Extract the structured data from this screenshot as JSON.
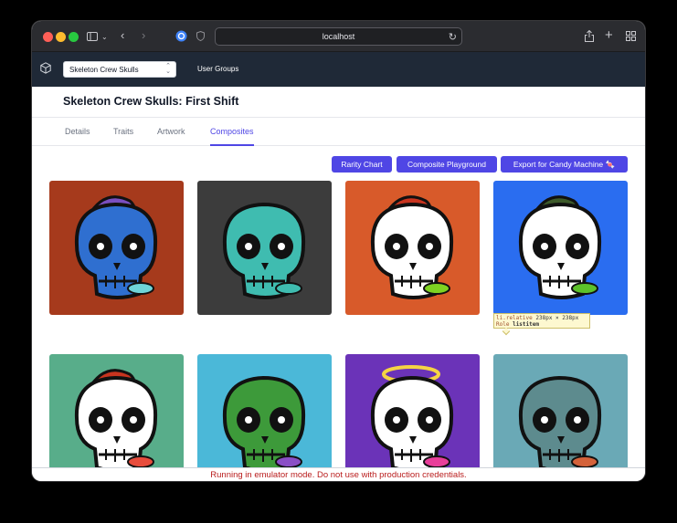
{
  "browser": {
    "url": "localhost"
  },
  "app": {
    "project_select": "Skeleton Crew Skulls",
    "nav_link": "User Groups"
  },
  "page": {
    "title": "Skeleton Crew Skulls: First Shift"
  },
  "tabs": [
    {
      "label": "Details"
    },
    {
      "label": "Traits"
    },
    {
      "label": "Artwork"
    },
    {
      "label": "Composites"
    }
  ],
  "active_tab": "Composites",
  "actions": {
    "rarity_chart": "Rarity Chart",
    "composite_playground": "Composite Playground",
    "export_candy_machine": "Export for Candy Machine 🍬"
  },
  "composites": [
    {
      "bg": "#a63a1c",
      "skull": "#2f6fd0",
      "hat": "#7a4fbf",
      "accent": "#6fd4d8"
    },
    {
      "bg": "#3c3c3c",
      "skull": "#3fbcb0",
      "hat": "none",
      "accent": "#3fbcb0"
    },
    {
      "bg": "#d85a2a",
      "skull": "#ffffff",
      "hat": "#c8341f",
      "accent": "#7ed321"
    },
    {
      "bg": "#2a6df0",
      "skull": "#ffffff",
      "hat": "#3d5a2a",
      "accent": "#5cc22a"
    },
    {
      "bg": "#58ad8a",
      "skull": "#ffffff",
      "hat": "#c8341f",
      "accent": "#e74c3c"
    },
    {
      "bg": "#4bb8d8",
      "skull": "#3d9a3a",
      "hat": "none",
      "accent": "#8a4fc6"
    },
    {
      "bg": "#6b33b8",
      "skull": "#ffffff",
      "hat": "#f5d443",
      "accent": "#e83e9a"
    },
    {
      "bg": "#6aa9b6",
      "skull": "#5d8b8e",
      "hat": "none",
      "accent": "#d4623a"
    }
  ],
  "devtools_tooltip": {
    "selector": "li.relative",
    "size": "238px × 238px",
    "role_label": "Role",
    "role_value": "listitem"
  },
  "emulator_warning": "Running in emulator mode. Do not use with production credentials.",
  "colors": {
    "accent": "#4f46e5",
    "nav_bg": "#1f2937",
    "warning_text": "#b91c1c"
  }
}
